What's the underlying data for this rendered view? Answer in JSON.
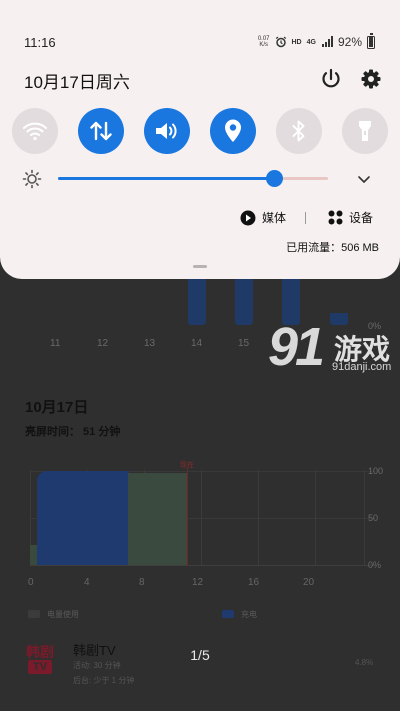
{
  "status_bar": {
    "time": "11:16",
    "net_speed_value": "0.07",
    "net_speed_unit": "K/s",
    "hd_label": "HD",
    "network_type": "4G",
    "battery_percent": "92%"
  },
  "panel": {
    "date": "10月17日周六",
    "tiles": [
      {
        "name": "wifi",
        "state": "off"
      },
      {
        "name": "mobile-data",
        "state": "on"
      },
      {
        "name": "sound",
        "state": "on"
      },
      {
        "name": "location",
        "state": "on"
      },
      {
        "name": "bluetooth",
        "state": "off"
      },
      {
        "name": "flashlight",
        "state": "off"
      }
    ],
    "brightness_level": 0.8,
    "media_label": "媒体",
    "devices_label": "设备",
    "data_usage": "已用流量：506 MB",
    "accent_color": "#1a77e0"
  },
  "background_app": {
    "week_ticks": [
      "11",
      "12",
      "13",
      "14",
      "15"
    ],
    "pct_zero": "0%",
    "date_heading": "10月17日",
    "screen_on_time": "亮屏时间： 51 分钟",
    "now_marker": "现在",
    "y_ticks": [
      "100",
      "50",
      "0%"
    ],
    "x_ticks": [
      "0",
      "4",
      "8",
      "12",
      "16",
      "20"
    ],
    "legend": [
      "电量使用",
      "充电"
    ],
    "app": {
      "icon_line1": "韩剧",
      "icon_line2": "TV",
      "name": "韩剧TV",
      "active": "活动: 30 分钟",
      "background": "后台: 少于 1 分钟",
      "percent": "4.8%"
    },
    "pager": "1/5"
  },
  "watermark": {
    "number": "91",
    "text": "游戏",
    "url": "91danji.com"
  }
}
